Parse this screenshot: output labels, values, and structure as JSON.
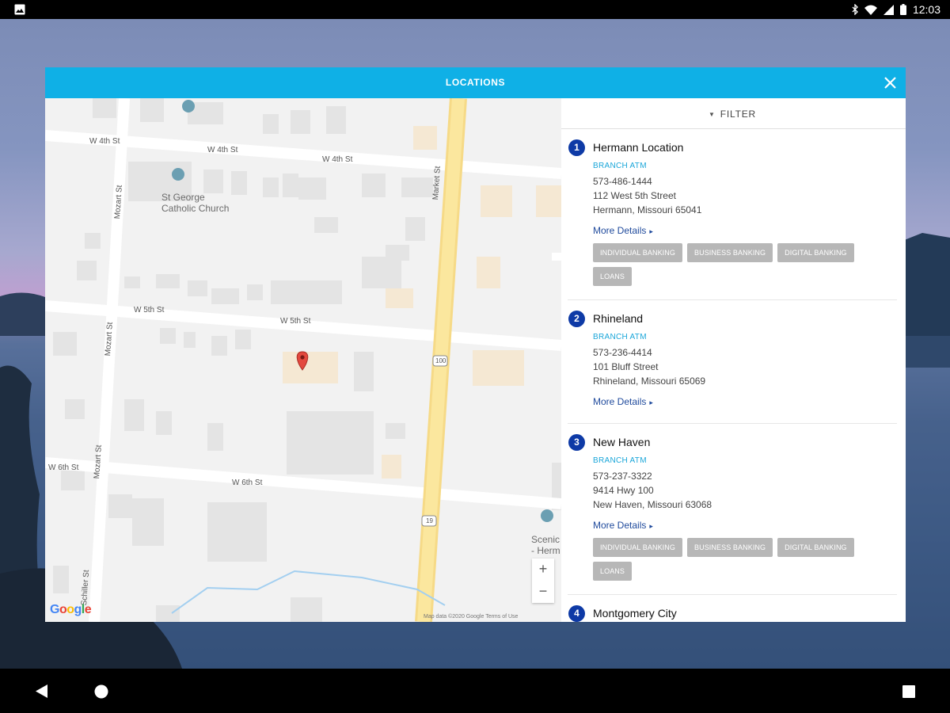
{
  "status_bar": {
    "time": "12:03",
    "icons": [
      "gallery-icon",
      "bluetooth-icon",
      "wifi-icon",
      "signal-icon",
      "battery-icon"
    ]
  },
  "dialog": {
    "title": "LOCATIONS",
    "header_color": "#0fb0e6",
    "close_icon": "close-icon"
  },
  "map": {
    "streets": [
      "W 4th St",
      "W 4th St",
      "W 4th St",
      "W 5th St",
      "W 5th St",
      "W 6th St",
      "W 6th St",
      "Market St",
      "Mozart St",
      "Mozart St",
      "Mozart St",
      "Schiller St"
    ],
    "route_shields": [
      "100",
      "19"
    ],
    "pois": [
      "St George\nCatholic Church",
      "Scenic\n- Herm"
    ],
    "zoom_in": "+",
    "zoom_out": "−",
    "logo": "Google",
    "footer": "Map data ©2020 Google    Terms of Use"
  },
  "filter": {
    "label": "FILTER",
    "icon": "caret-down-icon"
  },
  "locations": [
    {
      "number": "1",
      "name": "Hermann Location",
      "type": "BRANCH  ATM",
      "phone": "573-486-1444",
      "street": "112 West 5th Street",
      "city": "Hermann, Missouri 65041",
      "more": "More Details",
      "tags": [
        "INDIVIDUAL BANKING",
        "BUSINESS BANKING",
        "DIGITAL BANKING",
        "LOANS"
      ]
    },
    {
      "number": "2",
      "name": "Rhineland",
      "type": "BRANCH  ATM",
      "phone": "573-236-4414",
      "street": "101 Bluff Street",
      "city": "Rhineland, Missouri 65069",
      "more": "More Details",
      "tags": []
    },
    {
      "number": "3",
      "name": "New Haven",
      "type": "BRANCH  ATM",
      "phone": "573-237-3322",
      "street": "9414 Hwy 100",
      "city": "New Haven, Missouri 63068",
      "more": "More Details",
      "tags": [
        "INDIVIDUAL BANKING",
        "BUSINESS BANKING",
        "DIGITAL BANKING",
        "LOANS"
      ]
    },
    {
      "number": "4",
      "name": "Montgomery City"
    }
  ],
  "colors": {
    "badge": "#0e3aa6",
    "type_text": "#1aa6d9",
    "link": "#1f4a9c",
    "tag_bg": "#b7b7b7"
  }
}
